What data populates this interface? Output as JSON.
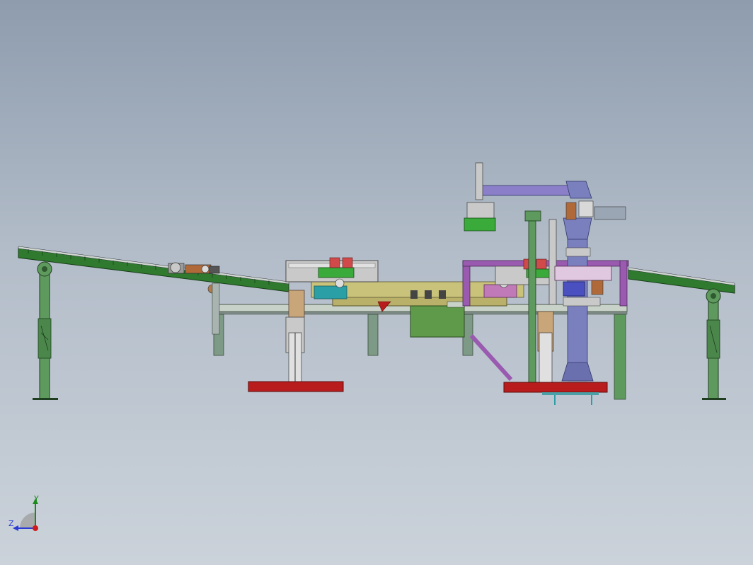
{
  "scene": {
    "description_icon": "cad-assembly-machine",
    "colors": {
      "conveyor_green": "#2f7a2f",
      "leg_green": "#5e9a5e",
      "frame_gray": "#7d8a86",
      "base_red": "#b81c1c",
      "table_khaki": "#b9b06a",
      "purple": "#9a5ab0",
      "blue_gray": "#6a6fae",
      "box_green": "#5f9a4a",
      "teal": "#2aa0a6"
    }
  },
  "triad": {
    "y_label": "Y",
    "z_label": "Z"
  }
}
